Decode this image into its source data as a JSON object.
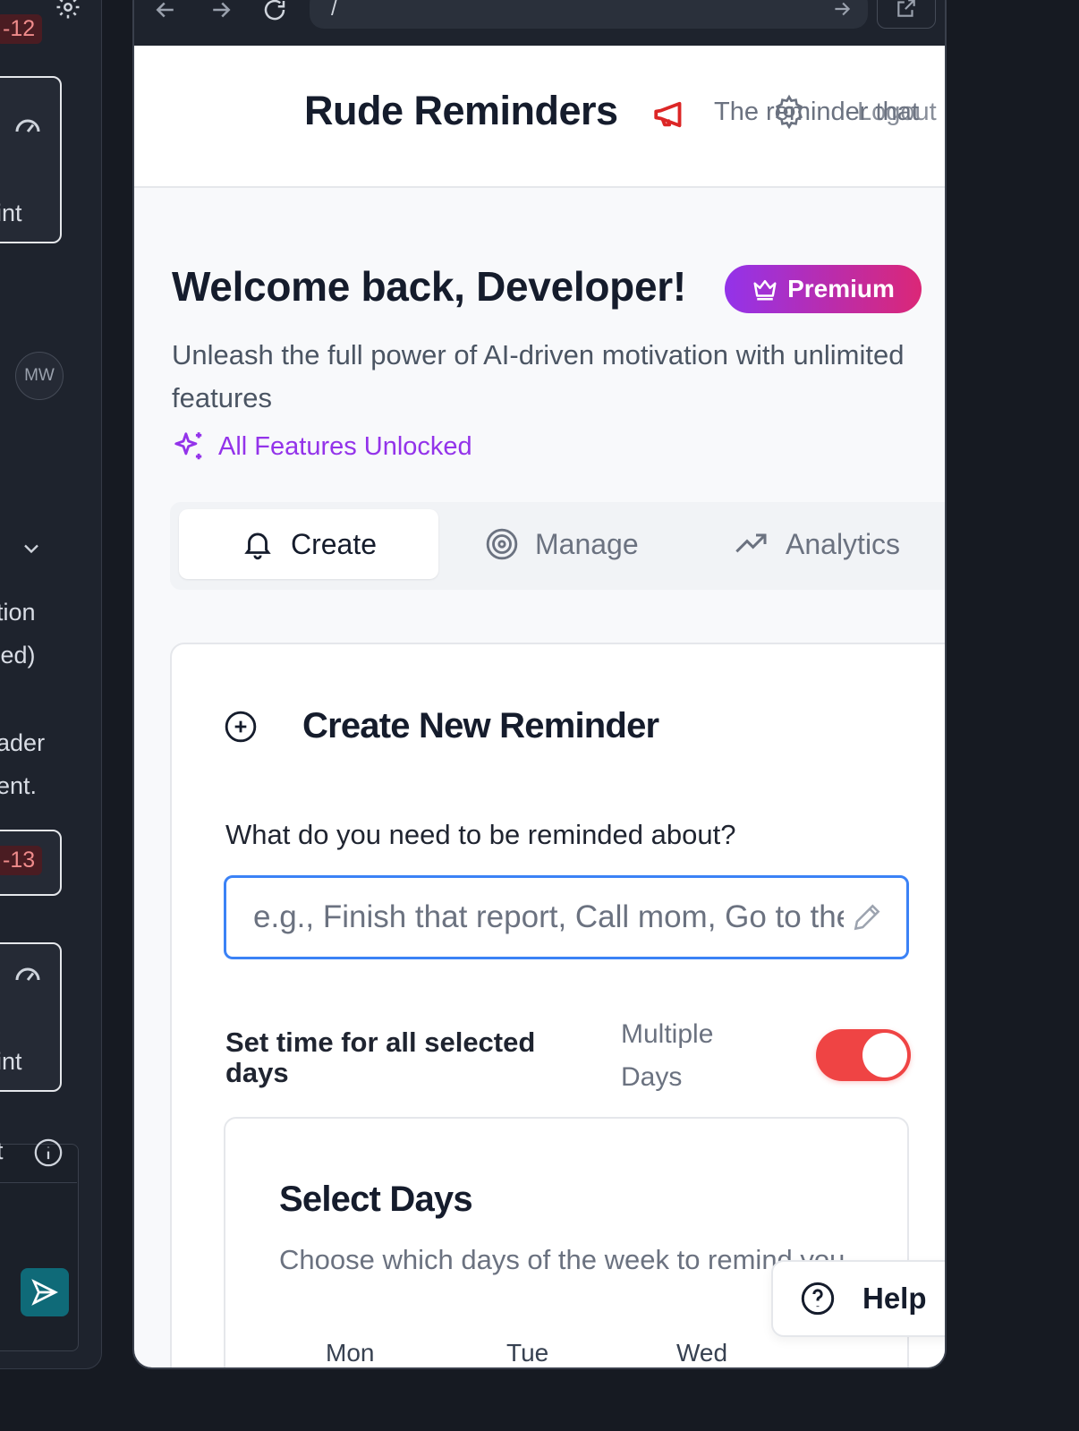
{
  "side_panel": {
    "badge_top": "-12",
    "item1_label": "oint",
    "avatar": "MW",
    "text_lines": [
      "ation",
      "ized)",
      "eader",
      "nent."
    ],
    "badge_mid": "-13",
    "item2_label": "oint",
    "composer_label": "et"
  },
  "browser": {
    "url": "/"
  },
  "app": {
    "title": "Rude Reminders",
    "tagline": "The reminder that",
    "tagline_overlap": "Logout"
  },
  "welcome": {
    "heading": "Welcome back, Developer!",
    "badge": "Premium",
    "subtitle": "Unleash the full power of AI-driven motivation with unlimited features",
    "unlocked": "All Features Unlocked"
  },
  "tabs": [
    {
      "label": "Create",
      "icon": "bell-icon"
    },
    {
      "label": "Manage",
      "icon": "target-icon"
    },
    {
      "label": "Analytics",
      "icon": "trending-up-icon"
    }
  ],
  "form": {
    "title": "Create New Reminder",
    "question": "What do you need to be reminded about?",
    "input_placeholder": "e.g., Finish that report, Call mom, Go to the gym",
    "input_value": "",
    "time_label": "Set time for all selected days",
    "multi_days_label": "Multiple Days",
    "multi_days_on": true
  },
  "days": {
    "title": "Select Days",
    "description": "Choose which days of the week to remind you",
    "items": [
      "Mon",
      "Tue",
      "Wed"
    ]
  },
  "help": {
    "label": "Help"
  },
  "colors": {
    "accent_blue": "#3b82f6",
    "premium_from": "#9333ea",
    "premium_to": "#db2777",
    "toggle_on": "#ef4444",
    "brand_red": "#dc2626"
  }
}
